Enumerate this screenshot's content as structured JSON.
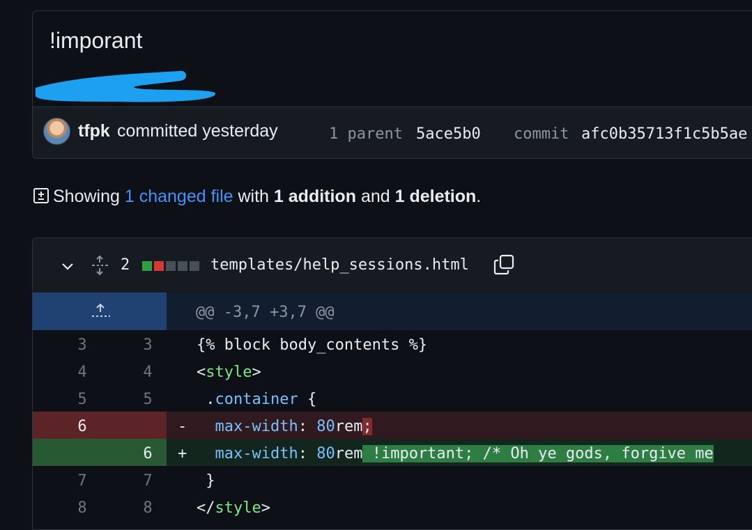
{
  "commit": {
    "title": "!imporant",
    "author": "tfpk",
    "committed_text": "committed yesterday",
    "parent_label": "1 parent",
    "parent_sha": "5ace5b0",
    "commit_label": "commit",
    "commit_sha": "afc0b35713f1c5b5ae"
  },
  "summary": {
    "prefix": "Showing",
    "changed": "1 changed file",
    "with": "with",
    "additions": "1 addition",
    "and": "and",
    "deletions": "1 deletion",
    "period": "."
  },
  "file": {
    "count": "2",
    "name": "templates/help_sessions.html",
    "blocks": [
      "#2ea043",
      "#da3633",
      "#484f58",
      "#484f58",
      "#484f58"
    ],
    "hunk": "@@ -3,7 +3,7 @@"
  },
  "lines": [
    {
      "old": "3",
      "new": "3",
      "code": "{% block body_contents %}"
    },
    {
      "old": "4",
      "new": "4",
      "lt": "<",
      "tag": "style",
      "gt": ">"
    },
    {
      "old": "5",
      "new": "5",
      "cls_prefix": " .",
      "cls": "container",
      "brace": " {"
    },
    {
      "old": "6",
      "new": "",
      "sign": "-",
      "prop": "max-width",
      "colon": ": ",
      "num": "80",
      "unit": "rem",
      "hl": ";"
    },
    {
      "old": "",
      "new": "6",
      "sign": "+",
      "prop": "max-width",
      "colon": ": ",
      "num": "80",
      "unit": "rem",
      "hl": " !important; /* Oh ye gods, forgive me"
    },
    {
      "old": "7",
      "new": "7",
      "code": " }"
    },
    {
      "old": "8",
      "new": "8",
      "lt": "</",
      "tag": "style",
      "gt": ">"
    }
  ],
  "colors": {
    "accent": "#4493f8",
    "bg": "#0d1117",
    "del": "#301a1f",
    "add": "#12261e"
  }
}
